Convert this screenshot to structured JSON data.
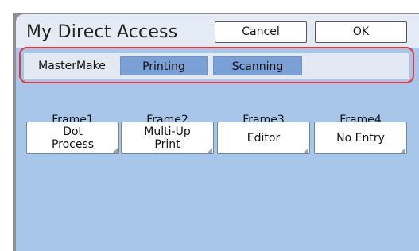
{
  "header": {
    "title": "My Direct Access",
    "cancel_label": "Cancel",
    "ok_label": "OK"
  },
  "tabs": [
    {
      "label": "MasterMake",
      "active": true
    },
    {
      "label": "Printing",
      "active": false
    },
    {
      "label": "Scanning",
      "active": false
    }
  ],
  "frames": [
    {
      "label": "Frame1",
      "entry": "Dot\nProcess"
    },
    {
      "label": "Frame2",
      "entry": "Multi-Up\nPrint"
    },
    {
      "label": "Frame3",
      "entry": "Editor"
    },
    {
      "label": "Frame4",
      "entry": "No Entry"
    }
  ],
  "colors": {
    "panel_background": "#a8c6ea",
    "inactive_tab": "#7ba0d6",
    "highlight_outline": "#e03a3e"
  }
}
